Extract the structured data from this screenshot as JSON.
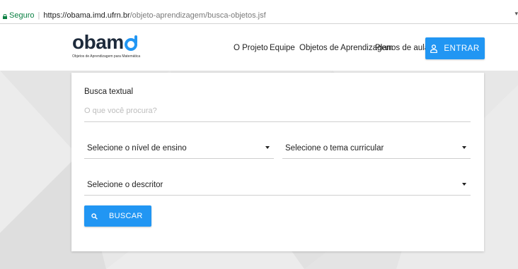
{
  "address_bar": {
    "secure_label": "Seguro",
    "separator": "|",
    "url_host": "https://obama.imd.ufrn.br",
    "url_path": "/objeto-aprendizagem/busca-objetos.jsf"
  },
  "header": {
    "logo_word": "obam",
    "logo_tagline": "Objetos de Aprendizagem para Matemática",
    "nav": [
      "O Projeto",
      "Equipe",
      "Objetos de Aprendizagem",
      "Planos de aula"
    ],
    "login_label": "ENTRAR"
  },
  "search_form": {
    "text_label": "Busca textual",
    "text_placeholder": "O que você procura?",
    "nivel_select": "Selecione o nível de ensino",
    "tema_select": "Selecione o tema curricular",
    "descritor_select": "Selecione o descritor",
    "search_button": "BUSCAR"
  },
  "colors": {
    "primary": "#2196f3",
    "logo_dark": "#1d2a3b",
    "secure_green": "#0b8043"
  }
}
